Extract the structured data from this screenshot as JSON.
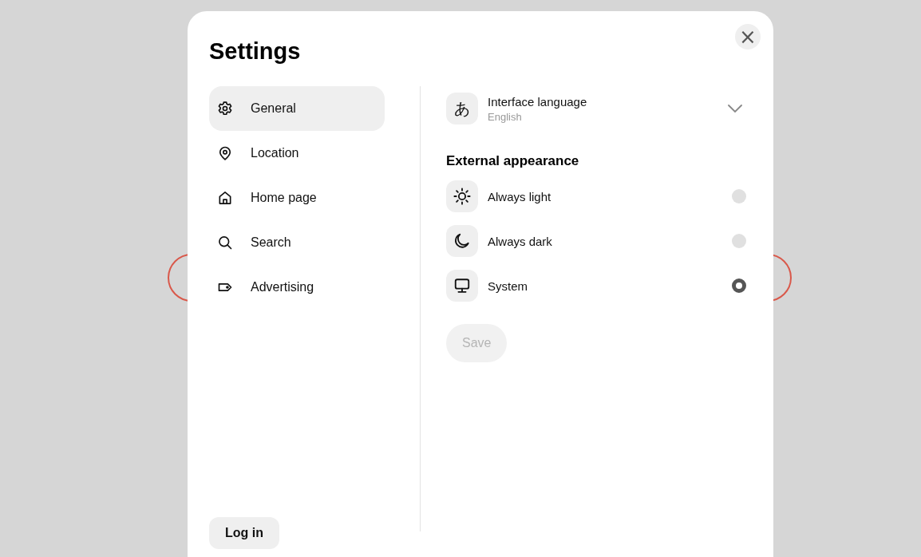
{
  "dialog": {
    "title": "Settings",
    "close": "×",
    "nav": [
      {
        "label": "General",
        "selected": true
      },
      {
        "label": "Location",
        "selected": false
      },
      {
        "label": "Home page",
        "selected": false
      },
      {
        "label": "Search",
        "selected": false
      },
      {
        "label": "Advertising",
        "selected": false
      }
    ],
    "login": "Log in",
    "language": {
      "icon_glyph": "あ",
      "label": "Interface language",
      "value": "English"
    },
    "appearance": {
      "heading": "External appearance",
      "options": [
        {
          "label": "Always light",
          "selected": false
        },
        {
          "label": "Always dark",
          "selected": false
        },
        {
          "label": "System",
          "selected": true
        }
      ]
    },
    "save": {
      "label": "Save",
      "disabled": true
    }
  }
}
